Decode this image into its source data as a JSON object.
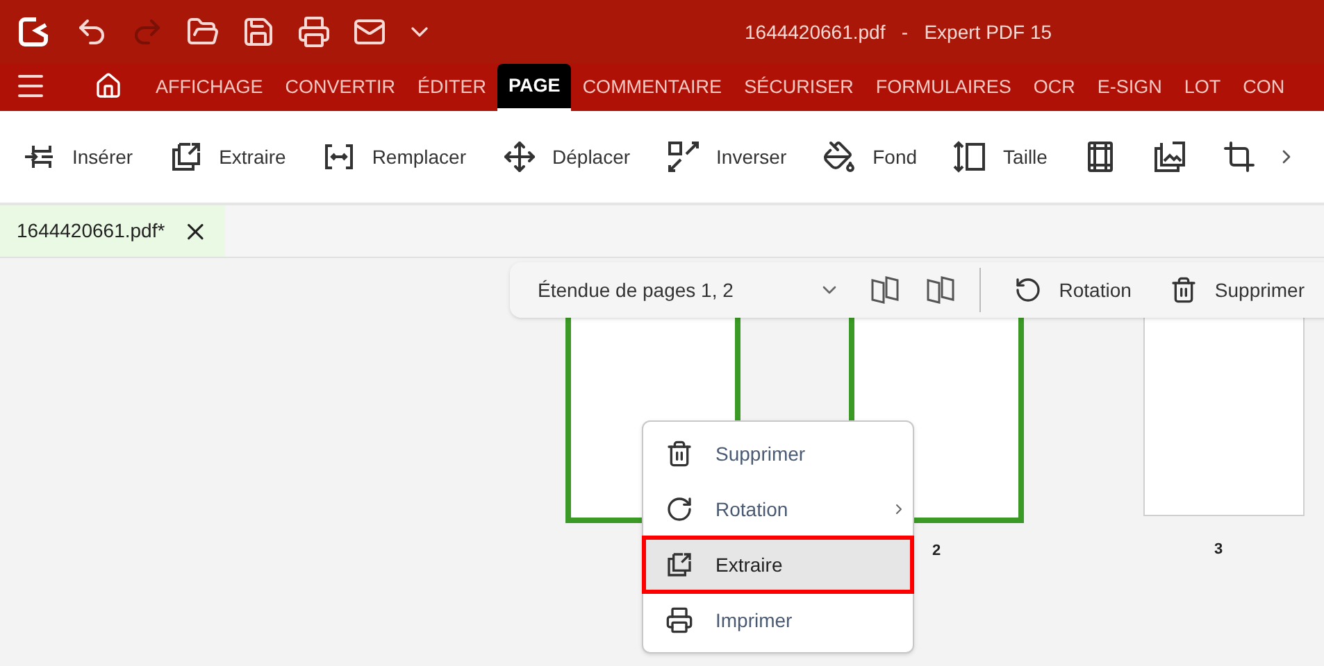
{
  "window": {
    "title": "1644420661.pdf   -   Expert PDF 15"
  },
  "quick_access": [
    {
      "disabled": false
    },
    {
      "disabled": true
    },
    {
      "disabled": false
    },
    {
      "disabled": false
    },
    {
      "disabled": false
    },
    {
      "disabled": false
    }
  ],
  "nav_tabs": [
    {
      "label": "AFFICHAGE",
      "selected": false
    },
    {
      "label": "CONVERTIR",
      "selected": false
    },
    {
      "label": "ÉDITER",
      "selected": false
    },
    {
      "label": "PAGE",
      "selected": true
    },
    {
      "label": "COMMENTAIRE",
      "selected": false
    },
    {
      "label": "SÉCURISER",
      "selected": false
    },
    {
      "label": "FORMULAIRES",
      "selected": false
    },
    {
      "label": "OCR",
      "selected": false
    },
    {
      "label": "E-SIGN",
      "selected": false
    },
    {
      "label": "LOT",
      "selected": false
    },
    {
      "label": "CON",
      "selected": false
    }
  ],
  "ribbon": [
    {
      "kind": "labeled",
      "label": "Insérer"
    },
    {
      "kind": "labeled",
      "label": "Extraire"
    },
    {
      "kind": "labeled",
      "label": "Remplacer"
    },
    {
      "kind": "labeled",
      "label": "Déplacer"
    },
    {
      "kind": "labeled",
      "label": "Inverser"
    },
    {
      "kind": "labeled",
      "label": "Fond"
    },
    {
      "kind": "labeled",
      "label": "Taille"
    },
    {
      "kind": "icon"
    },
    {
      "kind": "icon"
    },
    {
      "kind": "icon"
    }
  ],
  "document_tabs": [
    {
      "label": "1644420661.pdf*",
      "selected": true
    }
  ],
  "page_toolbar": {
    "range": "Étendue de pages 1, 2",
    "actions": [
      {
        "label": "Rotation"
      },
      {
        "label": "Supprimer"
      }
    ]
  },
  "pages": [
    {
      "selected": true
    },
    {
      "label": "2",
      "selected": true
    },
    {
      "label": "3",
      "selected": false
    }
  ],
  "context_menu": [
    {
      "label": "Supprimer",
      "highlighted": false,
      "submenu": false
    },
    {
      "label": "Rotation",
      "highlighted": false,
      "submenu": true
    },
    {
      "label": "Extraire",
      "highlighted": true,
      "submenu": false
    },
    {
      "label": "Imprimer",
      "highlighted": false,
      "submenu": false
    }
  ]
}
